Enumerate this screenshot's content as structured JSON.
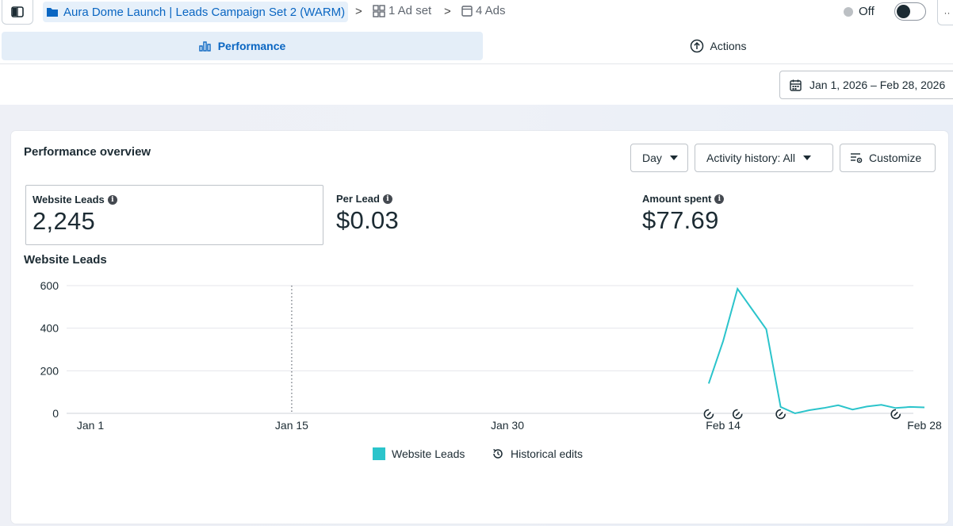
{
  "breadcrumb": {
    "campaign": "Aura Dome Launch | Leads Campaign Set 2 (WARM)",
    "adset": "1 Ad set",
    "ads": "4 Ads"
  },
  "status": {
    "label": "Off"
  },
  "tabs": {
    "performance": "Performance",
    "actions": "Actions"
  },
  "date_range": "Jan 1, 2026 – Feb 28, 2026",
  "overview": {
    "title": "Performance overview",
    "granularity": "Day",
    "activity": "Activity history: All",
    "customize": "Customize"
  },
  "metrics": [
    {
      "label": "Website Leads",
      "value": "2,245"
    },
    {
      "label": "Per Lead",
      "value": "$0.03"
    },
    {
      "label": "Amount spent",
      "value": "$77.69"
    }
  ],
  "colors": {
    "accent": "#0a66c2",
    "series": "#2bc4cb",
    "tab_bg": "#e4eef8"
  },
  "chart_data": {
    "type": "line",
    "title": "Website Leads",
    "x_ticks": [
      "Jan 1",
      "Jan 15",
      "Jan 30",
      "Feb 14",
      "Feb 28"
    ],
    "y_ticks": [
      0,
      200,
      400,
      600
    ],
    "ylim": [
      0,
      600
    ],
    "grid": true,
    "series": [
      {
        "name": "Website Leads",
        "x": [
          "Feb 13",
          "Feb 14",
          "Feb 15",
          "Feb 16",
          "Feb 17",
          "Feb 18",
          "Feb 19",
          "Feb 20",
          "Feb 21",
          "Feb 22",
          "Feb 23",
          "Feb 24",
          "Feb 25",
          "Feb 26",
          "Feb 27",
          "Feb 28"
        ],
        "values": [
          140,
          340,
          585,
          490,
          395,
          30,
          0,
          15,
          25,
          38,
          18,
          32,
          40,
          25,
          30,
          28
        ]
      }
    ],
    "reference_line_date": "Jan 15",
    "historical_edit_dates": [
      "Feb 13",
      "Feb 15",
      "Feb 18",
      "Feb 26"
    ],
    "legend": [
      "Website Leads",
      "Historical edits"
    ],
    "legend_position": "bottom-center"
  }
}
